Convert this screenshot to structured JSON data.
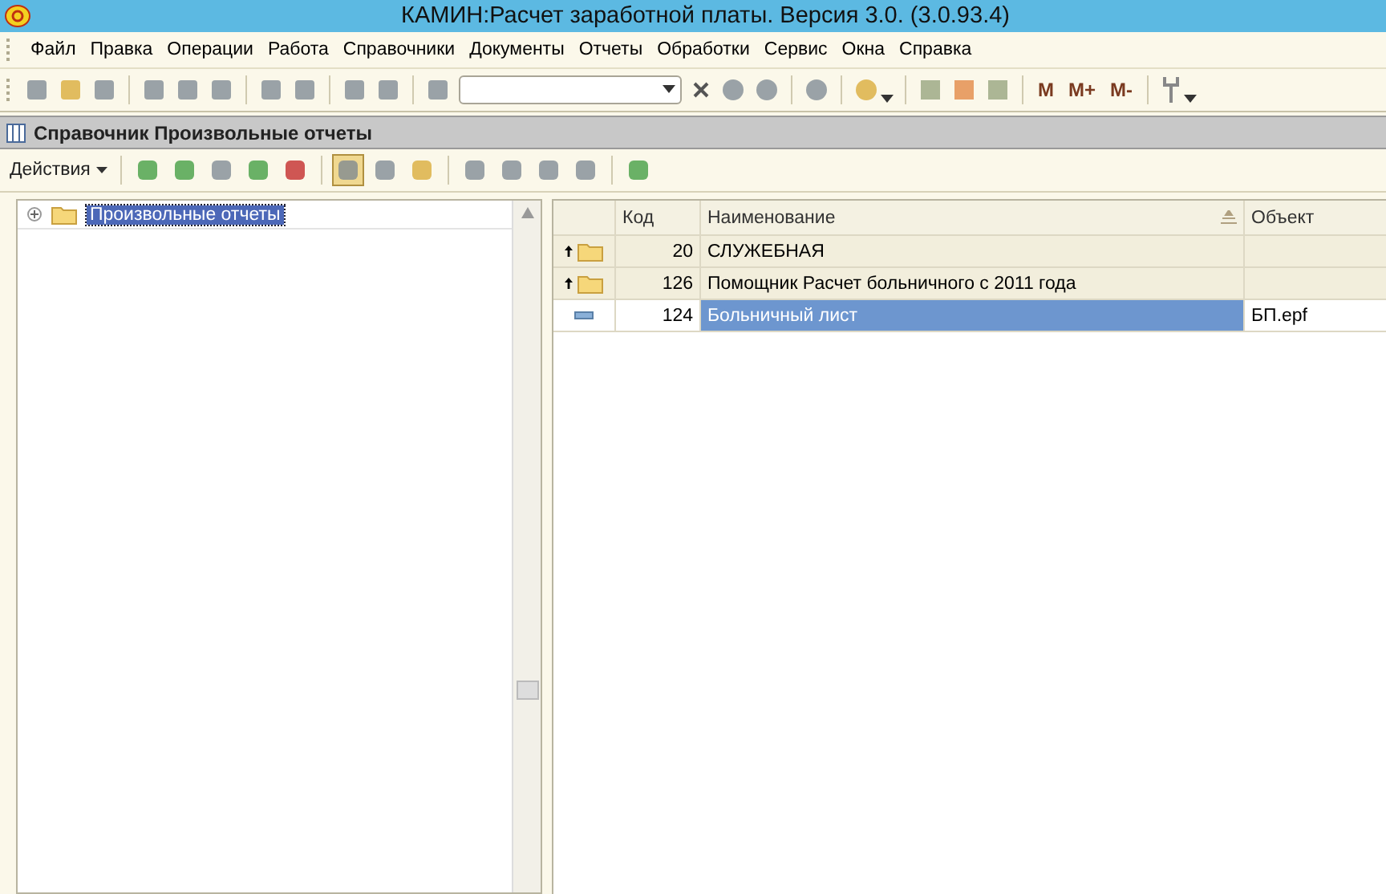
{
  "window": {
    "title": "КАМИН:Расчет заработной платы. Версия 3.0. (3.0.93.4)"
  },
  "menu": [
    "Файл",
    "Правка",
    "Операции",
    "Работа",
    "Справочники",
    "Документы",
    "Отчеты",
    "Обработки",
    "Сервис",
    "Окна",
    "Справка"
  ],
  "toolbar": {
    "memory_buttons": [
      "M",
      "M+",
      "M-"
    ]
  },
  "panel": {
    "title": "Справочник Произвольные отчеты",
    "actions_label": "Действия"
  },
  "tree": {
    "items": [
      {
        "label": "Произвольные отчеты",
        "selected": true,
        "expanded": false
      }
    ]
  },
  "table": {
    "columns": [
      "Код",
      "Наименование",
      "Объект"
    ],
    "rows": [
      {
        "kind": "group",
        "code": "20",
        "name": "СЛУЖЕБНАЯ",
        "object": "",
        "selected": false
      },
      {
        "kind": "group",
        "code": "126",
        "name": "Помощник Расчет больничного с 2011 года",
        "object": "",
        "selected": false
      },
      {
        "kind": "item",
        "code": "124",
        "name": "Больничный лист",
        "object": "БП.epf",
        "selected": true
      }
    ]
  }
}
